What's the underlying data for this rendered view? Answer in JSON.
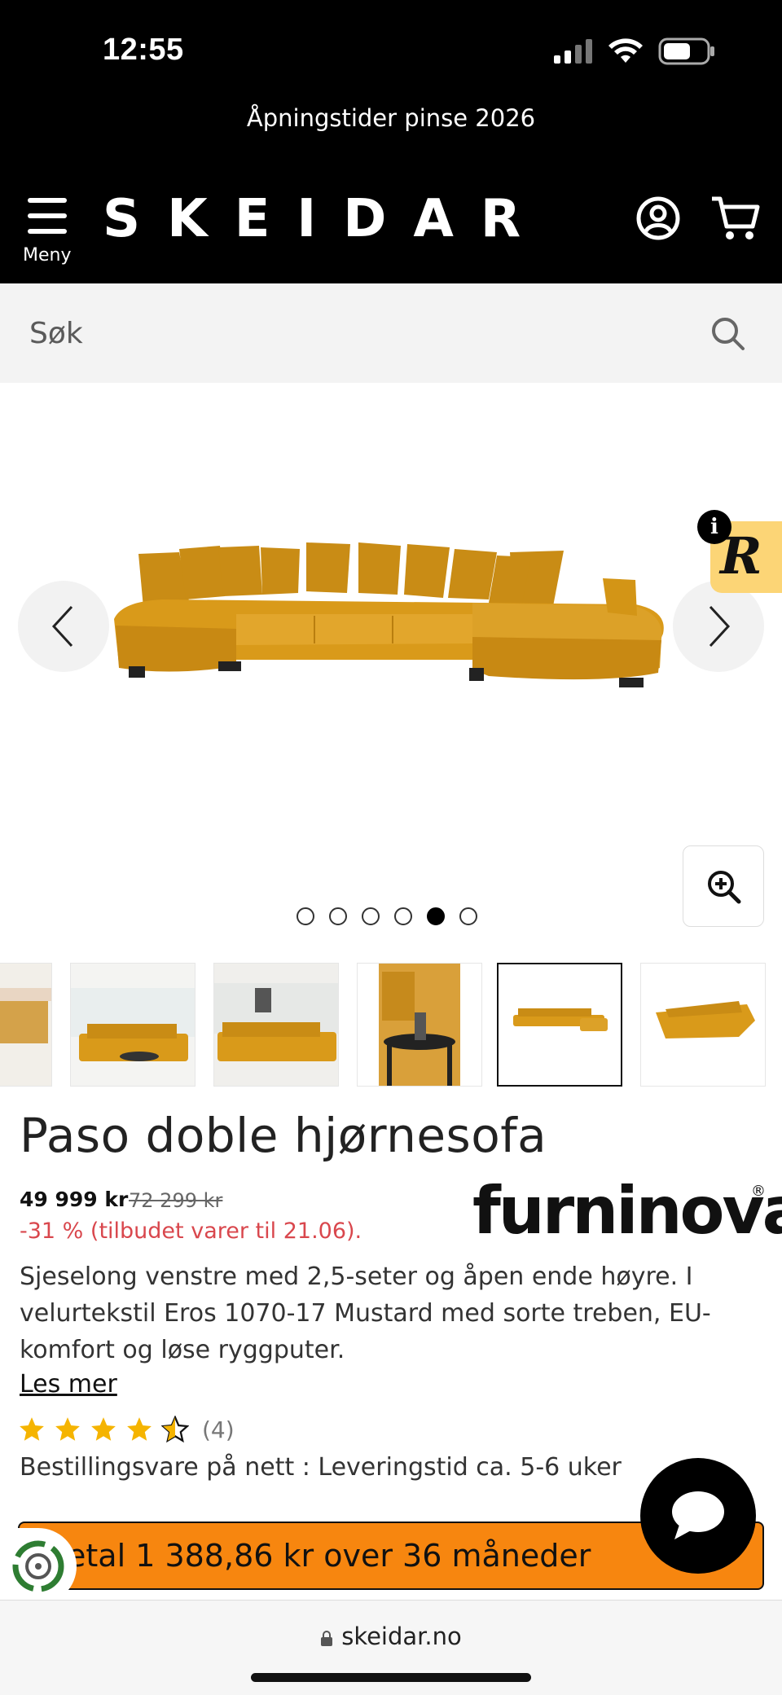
{
  "status_bar": {
    "time": "12:55"
  },
  "header": {
    "banner": "Åpningstider pinse 2026",
    "menu_label": "Meny",
    "logo": "SKEIDAR"
  },
  "search": {
    "placeholder": "Søk"
  },
  "gallery": {
    "dots_count": 6,
    "active_dot_index": 4,
    "badge_letter": "R",
    "info_letter": "i",
    "thumbnails_active_index": 4
  },
  "product": {
    "title": "Paso doble hjørnesofa",
    "price_now": "49 999 kr",
    "price_old": "72 299 kr",
    "discount": "-31 % (tilbudet varer til 21.06).",
    "brand": "furninova",
    "brand_mark": "®",
    "description": "Sjeselong venstre med 2,5-seter og åpen ende høyre. I velurtekstil Eros 1070-17 Mustard med sorte treben, EU-komfort og løse ryggputer.",
    "read_more": "Les mer",
    "rating": 4.5,
    "rating_count": "(4)",
    "delivery": "Bestillingsvare på nett : Leveringstid ca. 5-6 uker"
  },
  "finance": {
    "text": "etal 1 388,86 kr over 36 måneder"
  },
  "browser": {
    "url": "skeidar.no"
  },
  "colors": {
    "header_bg": "#000000",
    "accent_orange": "#f7860f",
    "discount_red": "#d9474d",
    "star_yellow": "#f5b400",
    "sofa_mustard": "#d99a1a"
  }
}
